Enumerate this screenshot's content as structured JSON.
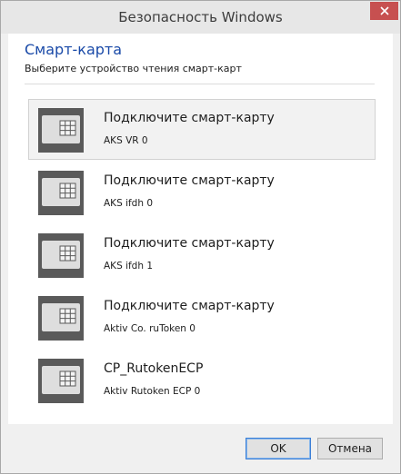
{
  "window": {
    "title": "Безопасность Windows"
  },
  "header": {
    "title": "Смарт-карта",
    "subtitle": "Выберите устройство чтения смарт-карт"
  },
  "devices": [
    {
      "title": "Подключите смарт-карту",
      "subtitle": "AKS VR 0",
      "selected": true
    },
    {
      "title": "Подключите смарт-карту",
      "subtitle": "AKS ifdh 0",
      "selected": false
    },
    {
      "title": "Подключите смарт-карту",
      "subtitle": "AKS ifdh 1",
      "selected": false
    },
    {
      "title": "Подключите смарт-карту",
      "subtitle": "Aktiv Co. ruToken 0",
      "selected": false
    },
    {
      "title": "CP_RutokenECP",
      "subtitle": "Aktiv Rutoken ECP 0",
      "selected": false
    }
  ],
  "buttons": {
    "ok": "OK",
    "cancel": "Отмена"
  },
  "icons": {
    "close": "close-icon",
    "card": "smart-card-icon"
  },
  "colors": {
    "accent": "#1a4aa8",
    "close": "#c75050"
  }
}
